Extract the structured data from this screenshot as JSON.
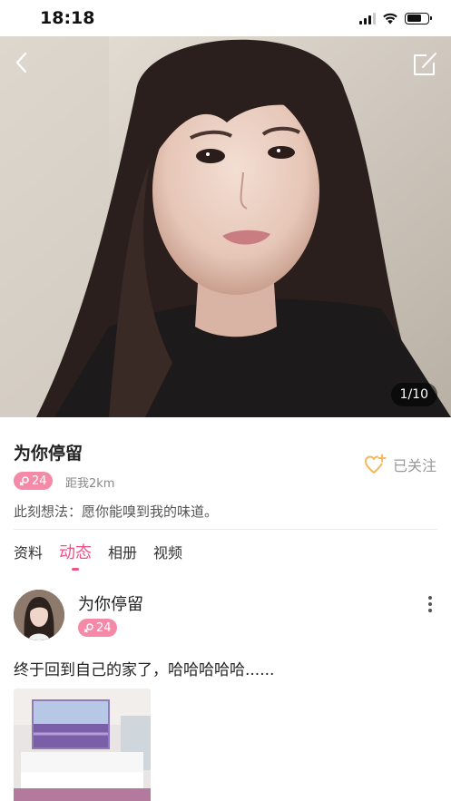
{
  "status_bar": {
    "time": "18:18",
    "icons": [
      "signal-icon",
      "wifi-icon",
      "battery-icon"
    ]
  },
  "hero": {
    "photo_counter": "1/10",
    "icons": [
      "back-chevron-icon",
      "edit-icon"
    ]
  },
  "profile": {
    "name": "为你停留",
    "age": "24",
    "distance": "距我2km",
    "follow_label": "已关注",
    "mood": "此刻想法：愿你能嗅到我的味道。"
  },
  "tabs": [
    {
      "label": "资料",
      "active": false
    },
    {
      "label": "动态",
      "active": true
    },
    {
      "label": "相册",
      "active": false
    },
    {
      "label": "视频",
      "active": false
    }
  ],
  "post": {
    "author": "为你停留",
    "age": "24",
    "text": "终于回到自己的家了，哈哈哈哈哈......"
  },
  "colors": {
    "accent": "#f0508a",
    "badge": "#f58aa8",
    "follow_heart": "#f6b85a"
  }
}
